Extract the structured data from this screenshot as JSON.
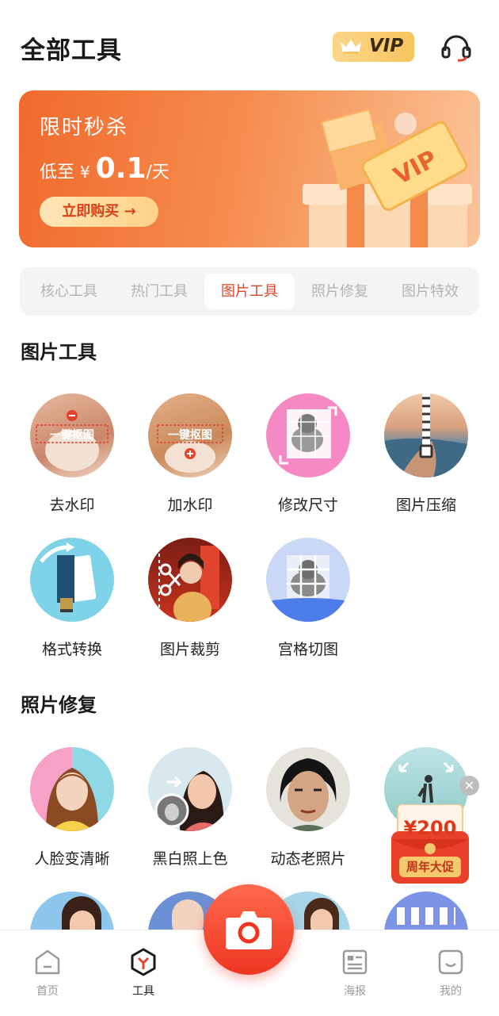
{
  "header": {
    "title": "全部工具",
    "vip_label": "VIP"
  },
  "banner": {
    "title": "限时秒杀",
    "prefix": "低至",
    "currency": "¥",
    "price": "0.1",
    "unit": "/天",
    "button": "立即购买 →",
    "ticket_text": "VIP"
  },
  "tabs": [
    {
      "label": "核心工具",
      "active": false
    },
    {
      "label": "热门工具",
      "active": false
    },
    {
      "label": "图片工具",
      "active": true
    },
    {
      "label": "照片修复",
      "active": false
    },
    {
      "label": "图片特效",
      "active": false
    }
  ],
  "sections": [
    {
      "title": "图片工具",
      "tools": [
        {
          "label": "去水印",
          "icon": "remove-watermark-icon",
          "caption": "一键抠图"
        },
        {
          "label": "加水印",
          "icon": "add-watermark-icon",
          "caption": "一键抠图"
        },
        {
          "label": "修改尺寸",
          "icon": "resize-icon"
        },
        {
          "label": "图片压缩",
          "icon": "compress-icon"
        },
        {
          "label": "格式转换",
          "icon": "format-convert-icon"
        },
        {
          "label": "图片裁剪",
          "icon": "crop-icon"
        },
        {
          "label": "宫格切图",
          "icon": "grid-cut-icon"
        }
      ]
    },
    {
      "title": "照片修复",
      "tools": [
        {
          "label": "人脸变清晰",
          "icon": "face-enhance-icon"
        },
        {
          "label": "黑白照上色",
          "icon": "colorize-icon"
        },
        {
          "label": "动态老照片",
          "icon": "animate-photo-icon"
        },
        {
          "label": "",
          "icon": "expand-photo-icon"
        }
      ]
    }
  ],
  "coupon": {
    "amount": "¥200",
    "tag": "周年大促"
  },
  "nav": [
    {
      "label": "首页",
      "icon": "home-icon",
      "active": false
    },
    {
      "label": "工具",
      "icon": "tools-icon",
      "active": true
    },
    {
      "label": "海报",
      "icon": "poster-icon",
      "active": false
    },
    {
      "label": "我的",
      "icon": "profile-icon",
      "active": false
    }
  ],
  "colors": {
    "accent": "#e0442c",
    "banner_start": "#f16a2d",
    "vip_gold": "#f7c45e"
  }
}
